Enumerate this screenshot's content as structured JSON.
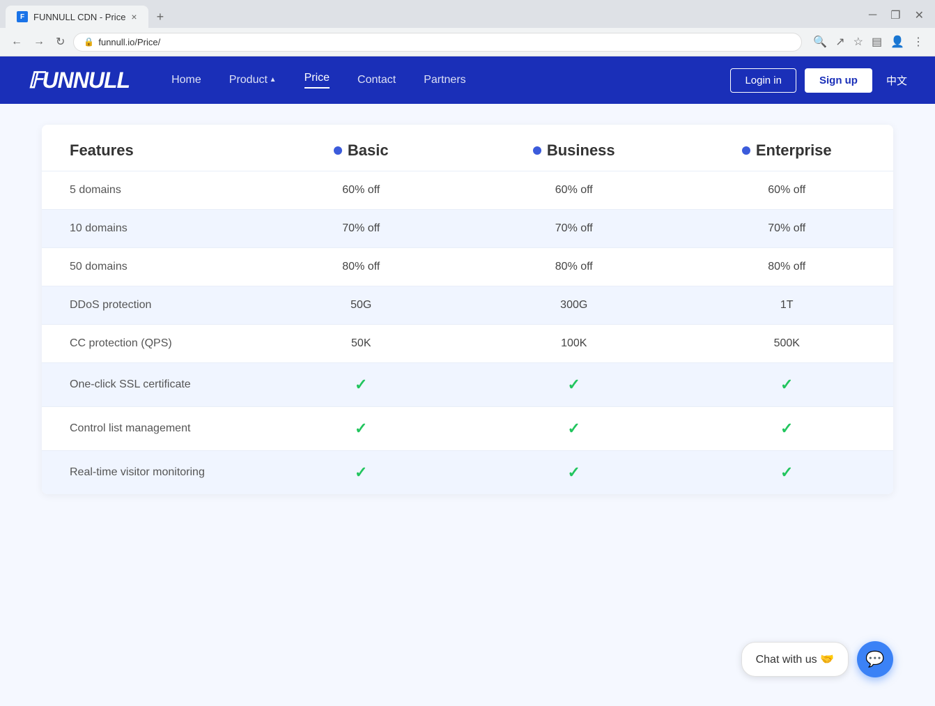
{
  "browser": {
    "tab_title": "FUNNULL CDN - Price",
    "url": "funnull.io/Price/",
    "new_tab_label": "+",
    "close_tab_label": "×",
    "nav_back": "←",
    "nav_forward": "→",
    "nav_refresh": "↻"
  },
  "header": {
    "logo": "FUNNULL",
    "logo_f": "F",
    "nav_items": [
      {
        "label": "Home",
        "active": false,
        "has_dropdown": false
      },
      {
        "label": "Product",
        "active": false,
        "has_dropdown": true
      },
      {
        "label": "Price",
        "active": true,
        "has_dropdown": false
      },
      {
        "label": "Contact",
        "active": false,
        "has_dropdown": false
      },
      {
        "label": "Partners",
        "active": false,
        "has_dropdown": false
      }
    ],
    "login_label": "Login in",
    "signup_label": "Sign up",
    "lang_label": "中文"
  },
  "pricing_table": {
    "col_features": "Features",
    "col_basic": "Basic",
    "col_business": "Business",
    "col_enterprise": "Enterprise",
    "rows": [
      {
        "feature": "5 domains",
        "basic": "60% off",
        "business": "60% off",
        "enterprise": "60% off",
        "type": "text",
        "shaded": false
      },
      {
        "feature": "10 domains",
        "basic": "70% off",
        "business": "70% off",
        "enterprise": "70% off",
        "type": "text",
        "shaded": true
      },
      {
        "feature": "50 domains",
        "basic": "80% off",
        "business": "80% off",
        "enterprise": "80% off",
        "type": "text",
        "shaded": false
      },
      {
        "feature": "DDoS protection",
        "basic": "50G",
        "business": "300G",
        "enterprise": "1T",
        "type": "text",
        "shaded": true
      },
      {
        "feature": "CC protection (QPS)",
        "basic": "50K",
        "business": "100K",
        "enterprise": "500K",
        "type": "text",
        "shaded": false
      },
      {
        "feature": "One-click SSL certificate",
        "basic": "✓",
        "business": "✓",
        "enterprise": "✓",
        "type": "check",
        "shaded": true
      },
      {
        "feature": "Control list management",
        "basic": "✓",
        "business": "✓",
        "enterprise": "✓",
        "type": "check",
        "shaded": false
      },
      {
        "feature": "Real-time visitor monitoring",
        "basic": "✓",
        "business": "✓",
        "enterprise": "✓",
        "type": "check",
        "shaded": true
      }
    ]
  },
  "chat": {
    "bubble_text": "Chat with us 🤝",
    "btn_icon": "💬"
  }
}
